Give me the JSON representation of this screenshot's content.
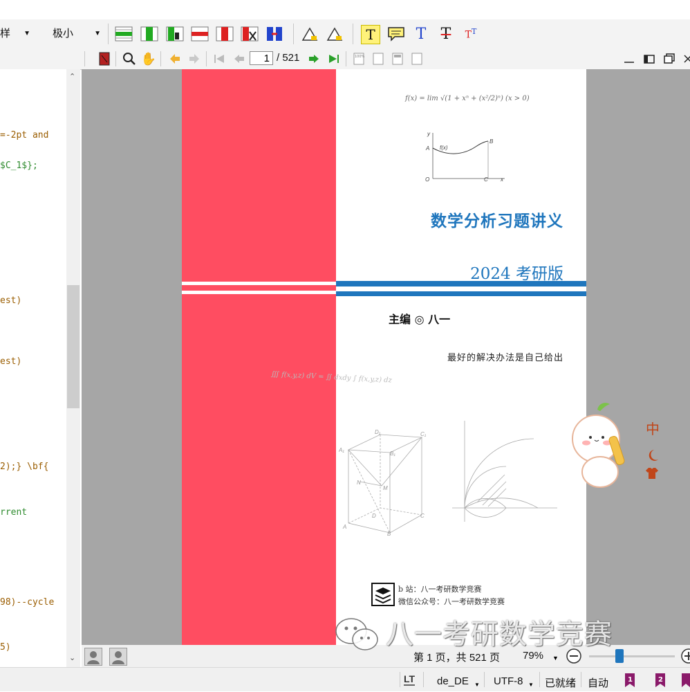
{
  "toolbar": {
    "combo1_value": "样",
    "combo2_value": "极小"
  },
  "viewer_toolbar": {
    "current_page": "1",
    "total_pages": "/ 521"
  },
  "editor": {
    "lines": [
      {
        "text": "=-2pt and",
        "color": "#9a5d00"
      },
      {
        "text": "$C_1$};",
        "color": "#2e8b2e"
      },
      {
        "text": "est)",
        "color": "#9a5d00"
      },
      {
        "text": "est)",
        "color": "#9a5d00"
      },
      {
        "text": "2);} \\bf{",
        "color": "#9a5d00"
      },
      {
        "text": "rrent",
        "color": "#2e8b2e"
      },
      {
        "text": "98)--cycle",
        "color": "#9a5d00"
      },
      {
        "text": "5)",
        "color": "#9a5d00"
      }
    ]
  },
  "pdf": {
    "formula_top": "f(x) = lim √(1 + xⁿ + (x²/2)ⁿ) (x > 0)",
    "graph": {
      "y_label": "y",
      "x_label": "x",
      "origin": "O",
      "a_label": "A",
      "b_label": "B",
      "c_label": "C",
      "curve_label": "f(x)"
    },
    "title": "数学分析习题讲义",
    "edition": "2024 考研版",
    "editor_credit": "主编 ◎ 八一",
    "motto": "最好的解决办法是自己给出",
    "integral": "∭ f(x,y,z) dV = ∬ dxdy ∫ f(x,y,z) dz",
    "cube_labels": [
      "D₁",
      "C₁",
      "A₁",
      "B₁",
      "N",
      "M",
      "D",
      "C",
      "A",
      "B"
    ],
    "bili": "b 站：八一考研数学竞赛",
    "wechat": "微信公众号：八一考研数学竞赛"
  },
  "sticker": {
    "char": "中"
  },
  "status": {
    "page_info": "第 1 页，共 521 页",
    "zoom": "79%",
    "language": "de_DE",
    "encoding": "UTF-8",
    "ready": "已就绪",
    "auto": "自动",
    "lt_badge": "LT"
  },
  "watermark": "八一考研数学竞赛",
  "colors": {
    "red_strip": "#ff4d61",
    "blue": "#1f76bd",
    "toolbar_bg": "#f3f3f3"
  }
}
